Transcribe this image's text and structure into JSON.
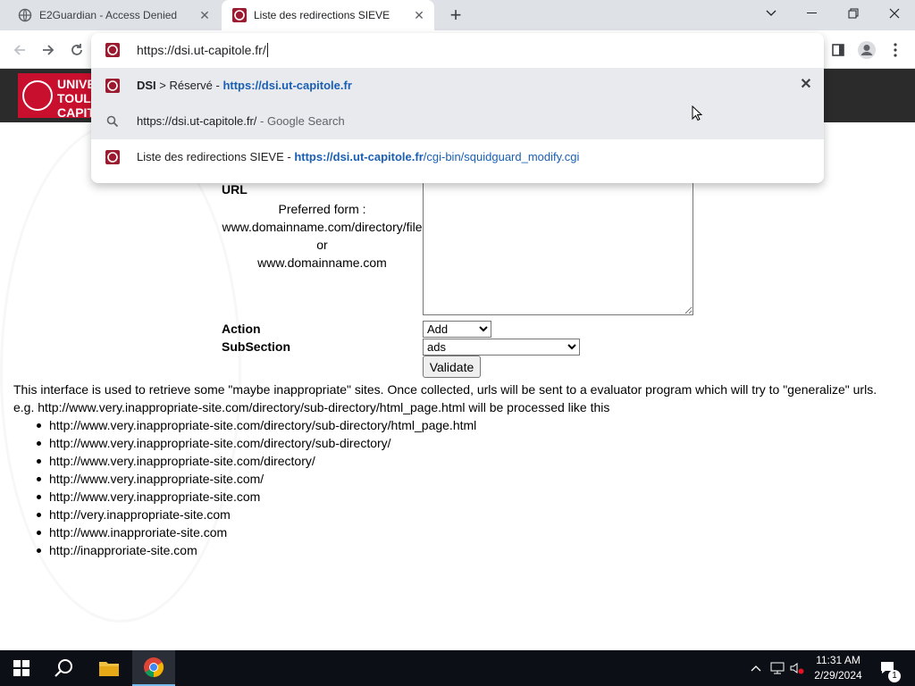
{
  "tabs": [
    {
      "title": "E2Guardian - Access Denied"
    },
    {
      "title": "Liste des redirections SIEVE"
    }
  ],
  "omnibox": {
    "value": "https://dsi.ut-capitole.fr/",
    "suggestions": [
      {
        "bold": "DSI",
        "sep": " > Réservé - ",
        "url": "https://dsi.ut-capitole.fr"
      },
      {
        "text": "https://dsi.ut-capitole.fr/",
        "suffix": " - Google Search"
      },
      {
        "text": "Liste des redirections SIEVE - ",
        "url_bold": "https://dsi.ut-capitole.fr",
        "url_rest": "/cgi-bin/squidguard_modify.cgi"
      }
    ]
  },
  "banner": {
    "logo_text": "UNIVERSITÉ TOULOUSE CAPITOLE"
  },
  "form": {
    "url_label": "URL",
    "preferred_line1": "Preferred form :",
    "preferred_line2": "www.domainname.com/directory/file",
    "preferred_line3": "or",
    "preferred_line4": "www.domainname.com",
    "action_label": "Action",
    "action_value": "Add",
    "subsection_label": "SubSection",
    "subsection_value": "ads",
    "validate_label": "Validate"
  },
  "description": {
    "line1": "This interface is used to retrieve some \"maybe inappropriate\" sites. Once collected, urls will be sent to a evaluator program which will try to \"generalize\" urls.",
    "line2": "e.g. http://www.very.inappropriate-site.com/directory/sub-directory/html_page.html will be processed like this"
  },
  "examples": [
    "http://www.very.inappropriate-site.com/directory/sub-directory/html_page.html",
    "http://www.very.inappropriate-site.com/directory/sub-directory/",
    "http://www.very.inappropriate-site.com/directory/",
    "http://www.very.inappropriate-site.com/",
    "http://www.very.inappropriate-site.com",
    "http://very.inappropriate-site.com",
    "http://www.inapproriate-site.com",
    "http://inapproriate-site.com"
  ],
  "taskbar": {
    "time": "11:31 AM",
    "date": "2/29/2024",
    "notification_count": "1"
  },
  "colors": {
    "accent": "#c8102e",
    "banner": "#2b2b2b",
    "link": "#1a5fb4"
  }
}
